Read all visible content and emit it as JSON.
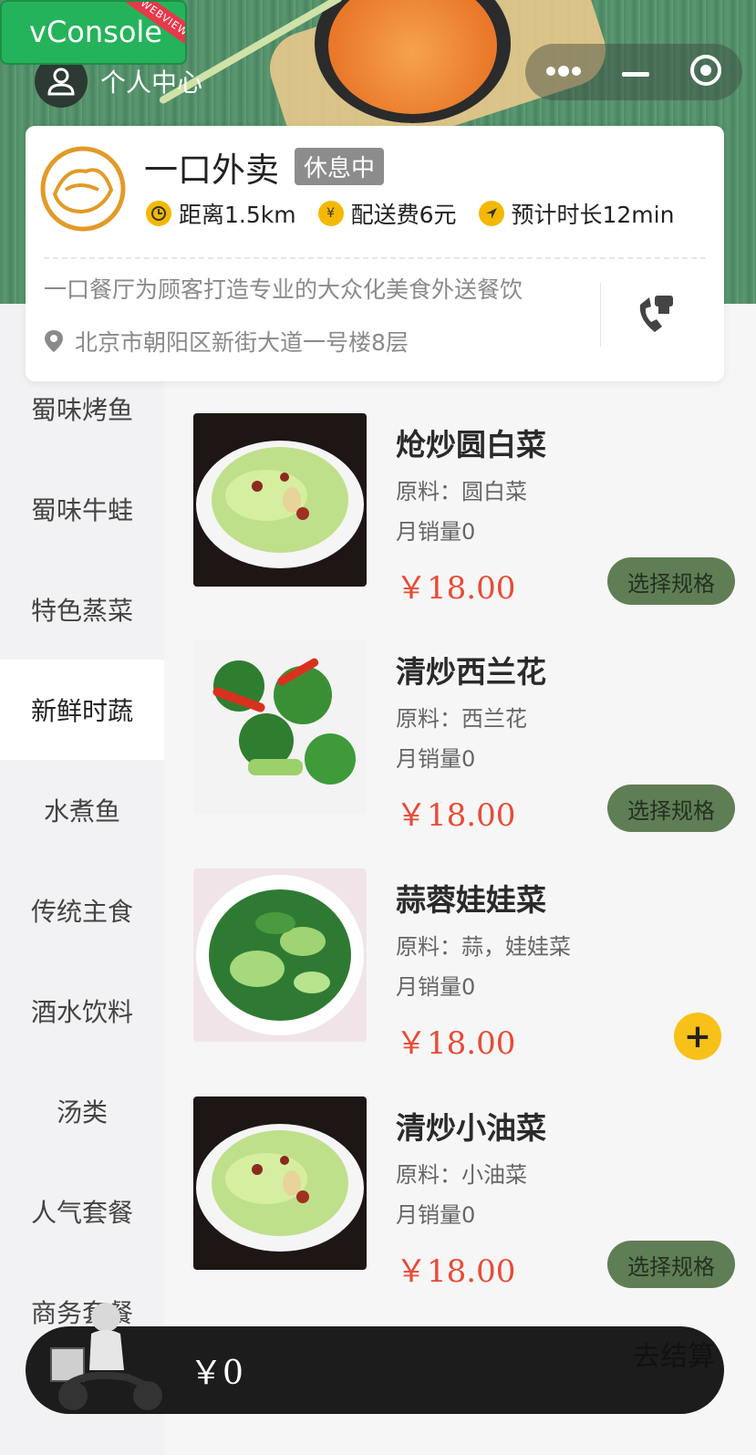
{
  "vconsole": {
    "label": "vConsole",
    "ribbon": "WEBVIEW"
  },
  "header": {
    "user_label": "个人中心"
  },
  "store": {
    "name": "一口外卖",
    "status": "休息中",
    "distance": "距离1.5km",
    "delivery_fee": "配送费6元",
    "eta": "预计时长12min",
    "description": "一口餐厅为顾客打造专业的大众化美食外送餐饮",
    "address": "北京市朝阳区新街大道一号楼8层"
  },
  "categories": [
    {
      "label": "蜀味烤鱼"
    },
    {
      "label": "蜀味牛蛙"
    },
    {
      "label": "特色蒸菜"
    },
    {
      "label": "新鲜时蔬"
    },
    {
      "label": "水煮鱼"
    },
    {
      "label": "传统主食"
    },
    {
      "label": "酒水饮料"
    },
    {
      "label": "汤类"
    },
    {
      "label": "人气套餐"
    },
    {
      "label": "商务套餐"
    }
  ],
  "active_category": "新鲜时蔬",
  "dishes": [
    {
      "name": "炝炒圆白菜",
      "ingredients": "原料：圆白菜",
      "sales": "月销量0",
      "price": "￥18.00",
      "action": "选择规格"
    },
    {
      "name": "清炒西兰花",
      "ingredients": "原料：西兰花",
      "sales": "月销量0",
      "price": "￥18.00",
      "action": "选择规格"
    },
    {
      "name": "蒜蓉娃娃菜",
      "ingredients": "原料：蒜，娃娃菜",
      "sales": "月销量0",
      "price": "￥18.00",
      "action": "+"
    },
    {
      "name": "清炒小油菜",
      "ingredients": "原料：小油菜",
      "sales": "月销量0",
      "price": "￥18.00",
      "action": "选择规格"
    }
  ],
  "cart": {
    "total": "￥0",
    "checkout_label": "去结算"
  },
  "colors": {
    "accent": "#5f7e55",
    "price": "#e84a35",
    "status": "#8c8c8c",
    "add": "#f8c11a"
  }
}
